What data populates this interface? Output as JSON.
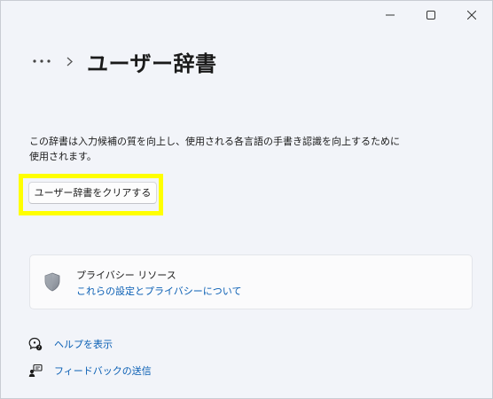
{
  "breadcrumb": {
    "more_icon": "more-horizontal-icon",
    "separator_icon": "chevron-right-icon",
    "title": "ユーザー辞書"
  },
  "description": "この辞書は入力候補の質を向上し、使用される各言語の手書き認識を向上するために使用されます。",
  "clear_button": {
    "label": "ユーザー辞書をクリアする"
  },
  "privacy_card": {
    "icon": "shield-icon",
    "title": "プライバシー リソース",
    "link": "これらの設定とプライバシーについて"
  },
  "footer": {
    "help": {
      "icon": "help-icon",
      "label": "ヘルプを表示"
    },
    "feedback": {
      "icon": "feedback-icon",
      "label": "フィードバックの送信"
    }
  },
  "colors": {
    "background": "#f2f4f9",
    "link": "#0a5fb4",
    "highlight": "#ffff00",
    "card": "#fbfbfc"
  }
}
